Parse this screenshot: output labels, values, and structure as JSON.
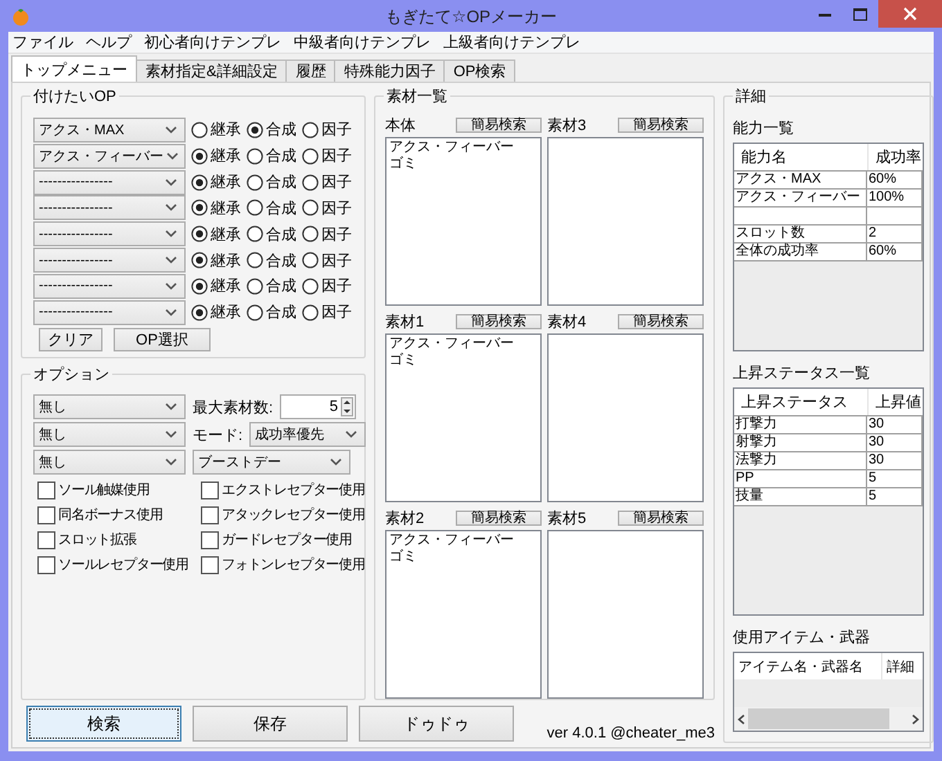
{
  "window": {
    "title": "もぎたて☆OPメーカー"
  },
  "menu": [
    "ファイル",
    "ヘルプ",
    "初心者向けテンプレ",
    "中級者向けテンプレ",
    "上級者向けテンプレ"
  ],
  "tabs": [
    {
      "label": "トップメニュー",
      "selected": true
    },
    {
      "label": "素材指定&詳細設定",
      "selected": false
    },
    {
      "label": "履歴",
      "selected": false
    },
    {
      "label": "特殊能力因子",
      "selected": false
    },
    {
      "label": "OP検索",
      "selected": false
    }
  ],
  "op_group": {
    "title": "付けたいOP",
    "rows": [
      {
        "op": "アクス・MAX",
        "options": [
          {
            "label": "継承",
            "selected": false
          },
          {
            "label": "合成",
            "selected": true
          },
          {
            "label": "因子",
            "selected": false
          }
        ]
      },
      {
        "op": "アクス・フィーバー",
        "options": [
          {
            "label": "継承",
            "selected": true
          },
          {
            "label": "合成",
            "selected": false
          },
          {
            "label": "因子",
            "selected": false
          }
        ]
      },
      {
        "op": "----------------",
        "options": [
          {
            "label": "継承",
            "selected": true
          },
          {
            "label": "合成",
            "selected": false
          },
          {
            "label": "因子",
            "selected": false
          }
        ]
      },
      {
        "op": "----------------",
        "options": [
          {
            "label": "継承",
            "selected": true
          },
          {
            "label": "合成",
            "selected": false
          },
          {
            "label": "因子",
            "selected": false
          }
        ]
      },
      {
        "op": "----------------",
        "options": [
          {
            "label": "継承",
            "selected": true
          },
          {
            "label": "合成",
            "selected": false
          },
          {
            "label": "因子",
            "selected": false
          }
        ]
      },
      {
        "op": "----------------",
        "options": [
          {
            "label": "継承",
            "selected": true
          },
          {
            "label": "合成",
            "selected": false
          },
          {
            "label": "因子",
            "selected": false
          }
        ]
      },
      {
        "op": "----------------",
        "options": [
          {
            "label": "継承",
            "selected": true
          },
          {
            "label": "合成",
            "selected": false
          },
          {
            "label": "因子",
            "selected": false
          }
        ]
      },
      {
        "op": "----------------",
        "options": [
          {
            "label": "継承",
            "selected": true
          },
          {
            "label": "合成",
            "selected": false
          },
          {
            "label": "因子",
            "selected": false
          }
        ]
      }
    ],
    "buttons": [
      "クリア",
      "OP選択"
    ]
  },
  "options": {
    "title": "オプション",
    "selects": [
      "無し",
      "無し",
      "無し"
    ],
    "max_materials": {
      "label": "最大素材数:",
      "value": "5"
    },
    "mode": {
      "label": "モード:",
      "value": "成功率優先"
    },
    "boost": "ブーストデー",
    "checkboxes": [
      {
        "label": "ソール触媒使用",
        "checked": false
      },
      {
        "label": "エクストレセプター使用",
        "checked": false
      },
      {
        "label": "同名ボーナス使用",
        "checked": false
      },
      {
        "label": "アタックレセプター使用",
        "checked": false
      },
      {
        "label": "スロット拡張",
        "checked": false
      },
      {
        "label": "ガードレセプター使用",
        "checked": false
      },
      {
        "label": "ソールレセプター使用",
        "checked": false
      },
      {
        "label": "フォトンレセプター使用",
        "checked": false
      }
    ]
  },
  "materials": {
    "title": "素材一覧",
    "panels": [
      {
        "label": "本体",
        "button": "簡易検索",
        "items": [
          "アクス・フィーバー",
          "ゴミ"
        ]
      },
      {
        "label": "素材3",
        "button": "簡易検索"
      },
      {
        "label": "素材1",
        "button": "簡易検索",
        "items": [
          "アクス・フィーバー",
          "ゴミ"
        ]
      },
      {
        "label": "素材4",
        "button": "簡易検索"
      },
      {
        "label": "素材2",
        "button": "簡易検索",
        "items": [
          "アクス・フィーバー",
          "ゴミ"
        ]
      },
      {
        "label": "素材5",
        "button": "簡易検索"
      }
    ]
  },
  "details": {
    "title": "詳細",
    "abilities": {
      "title": "能力一覧",
      "columns": [
        "能力名",
        "成功率"
      ],
      "rows": [
        {
          "kind": "entry",
          "name": "アクス・MAX",
          "value": "60%"
        },
        {
          "kind": "entry",
          "name": "アクス・フィーバー",
          "value": "100%"
        },
        {
          "kind": "blank"
        },
        {
          "kind": "entry",
          "name": "スロット数",
          "value": "2"
        },
        {
          "kind": "entry",
          "name": "全体の成功率",
          "value": "60%"
        }
      ]
    },
    "stats": {
      "title": "上昇ステータス一覧",
      "columns": [
        "上昇ステータス",
        "上昇値"
      ],
      "rows": [
        {
          "kind": "entry",
          "name": "打撃力",
          "value": "30"
        },
        {
          "kind": "entry",
          "name": "射撃力",
          "value": "30"
        },
        {
          "kind": "entry",
          "name": "法撃力",
          "value": "30"
        },
        {
          "kind": "entry",
          "name": "PP",
          "value": "5"
        },
        {
          "kind": "entry",
          "name": "技量",
          "value": "5"
        }
      ]
    },
    "items": {
      "title": "使用アイテム・武器",
      "columns": [
        "アイテム名・武器名",
        "詳細"
      ]
    }
  },
  "footer": {
    "buttons": [
      {
        "label": "検索",
        "focused": true
      },
      {
        "label": "保存",
        "focused": false
      },
      {
        "label": "ドゥドゥ",
        "focused": false
      }
    ],
    "version": "ver 4.0.1  @cheater_me3"
  }
}
